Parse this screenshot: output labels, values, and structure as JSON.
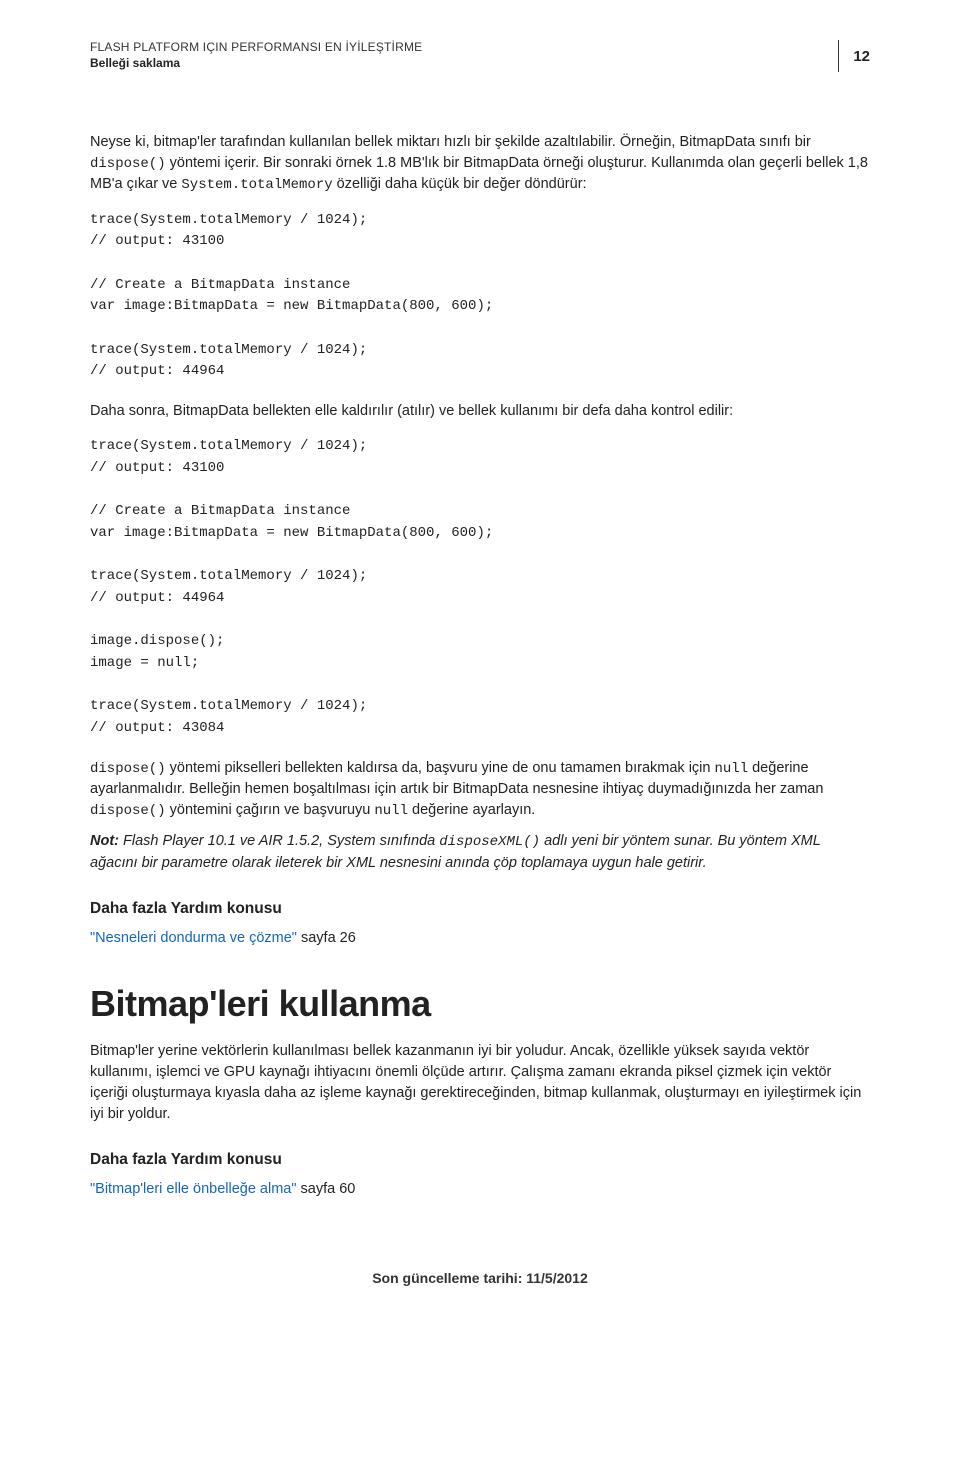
{
  "header": {
    "doc_title": "FLASH PLATFORM IÇIN PERFORMANSI EN İYİLEŞTİRME",
    "section_title": "Belleği saklama",
    "page_number": "12"
  },
  "para1_pre": "Neyse ki, bitmap'ler tarafından kullanılan bellek miktarı hızlı bir şekilde azaltılabilir. Örneğin, BitmapData sınıfı bir ",
  "para1_code": "dispose()",
  "para1_post": " yöntemi içerir. Bir sonraki örnek 1.8 MB'lık bir BitmapData örneği oluşturur. Kullanımda olan geçerli bellek 1,8 MB'a çıkar ve ",
  "para1_code2": "System.totalMemory",
  "para1_tail": " özelliği daha küçük bir değer döndürür:",
  "code1": "trace(System.totalMemory / 1024);\n// output: 43100\n\n// Create a BitmapData instance\nvar image:BitmapData = new BitmapData(800, 600);\n\ntrace(System.totalMemory / 1024);\n// output: 44964",
  "para2": "Daha sonra, BitmapData bellekten elle kaldırılır (atılır) ve bellek kullanımı bir defa daha kontrol edilir:",
  "code2": "trace(System.totalMemory / 1024);\n// output: 43100\n\n// Create a BitmapData instance\nvar image:BitmapData = new BitmapData(800, 600);\n\ntrace(System.totalMemory / 1024);\n// output: 44964\n\nimage.dispose();\nimage = null;\n\ntrace(System.totalMemory / 1024);\n// output: 43084",
  "para3_a": "dispose()",
  "para3_b": " yöntemi pikselleri bellekten kaldırsa da, başvuru yine de onu tamamen bırakmak için ",
  "para3_c": "null",
  "para3_d": " değerine ayarlanmalıdır. Belleğin hemen boşaltılması için artık bir BitmapData nesnesine ihtiyaç duymadığınızda her zaman ",
  "para3_e": "dispose()",
  "para3_f": " yöntemini çağırın ve başvuruyu ",
  "para3_g": "null",
  "para3_h": " değerine ayarlayın.",
  "note_label": "Not:",
  "note_a": "Flash Player 10.1 ve AIR 1.5.2, System sınıfında ",
  "note_code": "disposeXML()",
  "note_b": " adlı yeni bir yöntem sunar. Bu yöntem XML ağacını bir parametre olarak ileterek bir XML nesnesini anında çöp toplamaya uygun hale getirir.",
  "more_help_heading": "Daha fazla Yardım konusu",
  "more_help1_link": "\"Nesneleri dondurma ve çözme\"",
  "more_help1_tail": " sayfa 26",
  "big_heading": "Bitmap'leri kullanma",
  "para4": "Bitmap'ler yerine vektörlerin kullanılması bellek kazanmanın iyi bir yoludur. Ancak, özellikle yüksek sayıda vektör kullanımı, işlemci ve GPU kaynağı ihtiyacını önemli ölçüde artırır. Çalışma zamanı ekranda piksel çizmek için vektör içeriği oluşturmaya kıyasla daha az işleme kaynağı gerektireceğinden, bitmap kullanmak, oluşturmayı en iyileştirmek için iyi bir yoldur.",
  "more_help_heading2": "Daha fazla Yardım konusu",
  "more_help2_link": "\"Bitmap'leri elle önbelleğe alma\"",
  "more_help2_tail": " sayfa 60",
  "footer": "Son güncelleme tarihi: 11/5/2012"
}
